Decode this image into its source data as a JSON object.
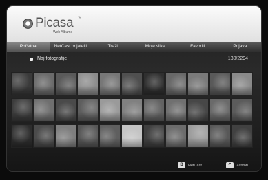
{
  "app": {
    "logo_text": "Picasa",
    "logo_tm": "™",
    "logo_subtitle": "Web Albums"
  },
  "nav": {
    "items": [
      {
        "label": "Početna",
        "active": true
      },
      {
        "label": "NetCast prijatelji",
        "active": false
      },
      {
        "label": "Traži",
        "active": false
      },
      {
        "label": "Moje slike",
        "active": false
      },
      {
        "label": "Favoriti",
        "active": false
      },
      {
        "label": "Prijava",
        "active": false
      }
    ]
  },
  "section": {
    "title": "Naj fotografije",
    "count": "130/2294"
  },
  "thumbnails": {
    "rows": 3,
    "columns": 11,
    "colors": [
      "#3a3a3a",
      "#6b6b6b",
      "#5a5a5a",
      "#8c8c8c",
      "#777777",
      "#4f4f4f",
      "#2f2f2f",
      "#686868",
      "#7a7a7a",
      "#595959",
      "#8a8a8a",
      "#3c3c3c",
      "#6f6f6f",
      "#4a4a4a",
      "#5e5e5e",
      "#9a9a9a",
      "#808080",
      "#626262",
      "#707070",
      "#474747",
      "#6a6a6a",
      "#5b5b5b",
      "#2d2d2d",
      "#4b4b4b",
      "#7e7e7e",
      "#565656",
      "#5f5f5f",
      "#c4c4c4",
      "#3f3f3f",
      "#6c6c6c",
      "#9b9b9b",
      "#585858",
      "#414141"
    ]
  },
  "footer": {
    "netcast_key": "B",
    "netcast_label": "NetCast",
    "back_key": "↶",
    "back_label": "Zatvori"
  }
}
